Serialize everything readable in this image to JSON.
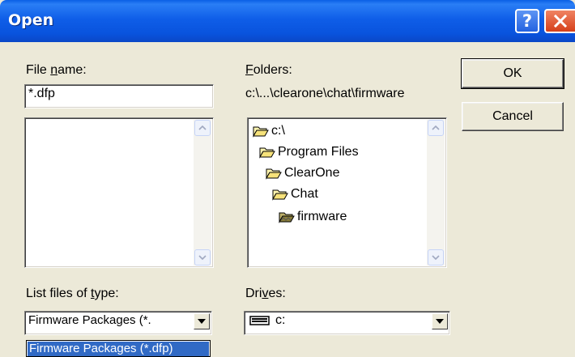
{
  "window": {
    "title": "Open",
    "help_glyph": "?",
    "close_glyph": "✕"
  },
  "file_name": {
    "label_pre": "File ",
    "label_mnemonic": "n",
    "label_post": "ame:",
    "value": "*.dfp"
  },
  "folders": {
    "label_mnemonic": "F",
    "label_post": "olders:",
    "current_path": "c:\\...\\clearone\\chat\\firmware",
    "tree": [
      {
        "label": "c:\\",
        "icon": "open-folder-icon"
      },
      {
        "label": "Program Files",
        "icon": "open-folder-icon"
      },
      {
        "label": "ClearOne",
        "icon": "open-folder-icon"
      },
      {
        "label": "Chat",
        "icon": "open-folder-icon"
      },
      {
        "label": "firmware",
        "icon": "selected-folder-icon"
      }
    ]
  },
  "file_type": {
    "label_pre": "List files of ",
    "label_mnemonic": "t",
    "label_post": "ype:",
    "selected": "Firmware Packages  (*.",
    "dropdown_options": [
      "Firmware Packages  (*.dfp)"
    ]
  },
  "drives": {
    "label_pre": "Dri",
    "label_mnemonic": "v",
    "label_post": "es:",
    "selected": "c:",
    "icon": "drive-icon"
  },
  "buttons": {
    "ok": "OK",
    "cancel": "Cancel"
  },
  "colors": {
    "title_bar": "#0a5fe6",
    "dialog_bg": "#ece9d8",
    "selection": "#316ac5",
    "close_button": "#d5401a"
  }
}
